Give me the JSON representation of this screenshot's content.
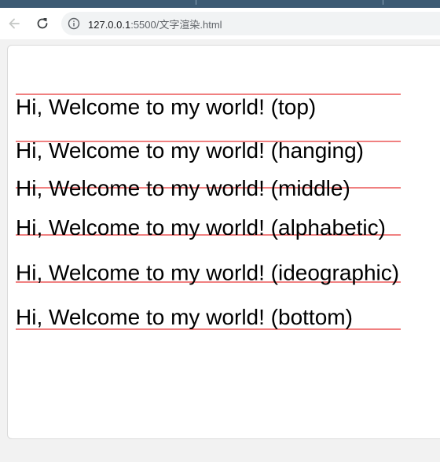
{
  "browser": {
    "url_host": "127.0.0.1",
    "url_rest": ":5500/文字渲染.html"
  },
  "canvas": {
    "text_prefix": "Hi, Welcome to my world!",
    "line_color": "#e00000",
    "text_color": "#000000",
    "rows": [
      {
        "baseline": "top",
        "label": "(top)"
      },
      {
        "baseline": "hanging",
        "label": "(hanging)"
      },
      {
        "baseline": "middle",
        "label": "(middle)"
      },
      {
        "baseline": "alphabetic",
        "label": "(alphabetic)"
      },
      {
        "baseline": "ideographic",
        "label": "(ideographic)"
      },
      {
        "baseline": "bottom",
        "label": "(bottom)"
      }
    ]
  }
}
